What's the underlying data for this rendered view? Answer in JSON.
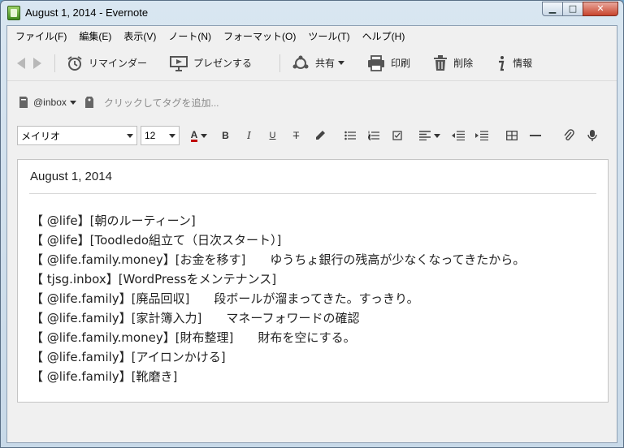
{
  "window": {
    "title": "August 1, 2014 - Evernote",
    "min": "▁",
    "max": "□",
    "close": "✕"
  },
  "menu": [
    "ファイル(F)",
    "編集(E)",
    "表示(V)",
    "ノート(N)",
    "フォーマット(O)",
    "ツール(T)",
    "ヘルプ(H)"
  ],
  "toolbar": {
    "reminder": "リマインダー",
    "present": "プレゼンする",
    "share": "共有",
    "print": "印刷",
    "delete": "削除",
    "info": "情報"
  },
  "tags": {
    "notebook": "@inbox",
    "placeholder": "クリックしてタグを追加..."
  },
  "format": {
    "font": "メイリオ",
    "size": "12",
    "bold": "B",
    "italic": "I",
    "underline": "U",
    "strike": "T"
  },
  "note": {
    "title": "August 1, 2014",
    "lines": [
      "【 @life】[朝のルーティーン]",
      "【 @life】[Toodledo組立て（日次スタート）]",
      "【 @life.family.money】[お金を移す]　　ゆうちょ銀行の残高が少なくなってきたから。",
      "【 tjsg.inbox】[WordPressをメンテナンス]",
      "【 @life.family】[廃品回収]　　段ボールが溜まってきた。すっきり。",
      "【 @life.family】[家計簿入力]　　マネーフォワードの確認",
      "【 @life.family.money】[財布整理]　　財布を空にする。",
      "【 @life.family】[アイロンかける]",
      "【 @life.family】[靴磨き]"
    ]
  },
  "colors": {
    "accent_green": "#3f8a1e",
    "close_red": "#c8442d",
    "text_color_bar": "#c00000"
  }
}
